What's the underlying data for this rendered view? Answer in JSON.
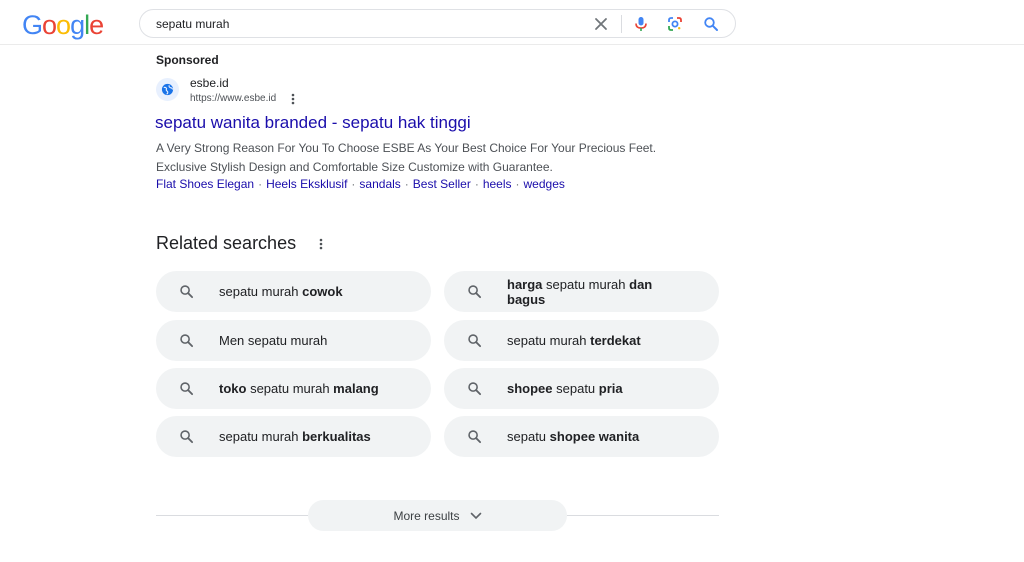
{
  "colors": {
    "link": "#1a0dab",
    "text": "#202124",
    "secondary": "#4d5156",
    "chip_bg": "#f1f3f4",
    "google_blue": "#4285F4",
    "google_red": "#EA4335",
    "google_yellow": "#FBBC05",
    "google_green": "#34A853"
  },
  "header": {
    "logo": [
      "G",
      "o",
      "o",
      "g",
      "l",
      "e"
    ],
    "search_value": "sepatu murah",
    "icons": [
      "clear-icon",
      "mic-icon",
      "lens-icon",
      "search-icon"
    ]
  },
  "ad": {
    "sponsored_label": "Sponsored",
    "site_name": "esbe.id",
    "site_url": "https://www.esbe.id",
    "title": "sepatu wanita branded - sepatu hak tinggi",
    "desc_line1": "A Very Strong Reason For You To Choose ESBE As Your Best Choice For Your Precious Feet.",
    "desc_line2": "Exclusive Stylish Design and Comfortable Size Customize with Guarantee.",
    "sitelinks": [
      "Flat Shoes Elegan",
      "Heels Eksklusif",
      "sandals",
      "Best Seller",
      "heels",
      "wedges"
    ],
    "sitelink_separator": "·"
  },
  "related": {
    "title": "Related searches",
    "items": [
      {
        "parts": [
          {
            "t": "sepatu murah ",
            "b": false
          },
          {
            "t": "cowok",
            "b": true
          }
        ]
      },
      {
        "parts": [
          {
            "t": "harga",
            "b": true
          },
          {
            "t": " sepatu murah ",
            "b": false
          },
          {
            "t": "dan bagus",
            "b": true
          }
        ]
      },
      {
        "parts": [
          {
            "t": "Men sepatu murah",
            "b": false
          }
        ]
      },
      {
        "parts": [
          {
            "t": "sepatu murah ",
            "b": false
          },
          {
            "t": "terdekat",
            "b": true
          }
        ]
      },
      {
        "parts": [
          {
            "t": "toko",
            "b": true
          },
          {
            "t": " sepatu murah ",
            "b": false
          },
          {
            "t": "malang",
            "b": true
          }
        ]
      },
      {
        "parts": [
          {
            "t": "shopee",
            "b": true
          },
          {
            "t": " sepatu ",
            "b": false
          },
          {
            "t": "pria",
            "b": true
          }
        ]
      },
      {
        "parts": [
          {
            "t": "sepatu murah ",
            "b": false
          },
          {
            "t": "berkualitas",
            "b": true
          }
        ]
      },
      {
        "parts": [
          {
            "t": "sepatu ",
            "b": false
          },
          {
            "t": "shopee wanita",
            "b": true
          }
        ]
      }
    ]
  },
  "more_results": {
    "label": "More results"
  }
}
